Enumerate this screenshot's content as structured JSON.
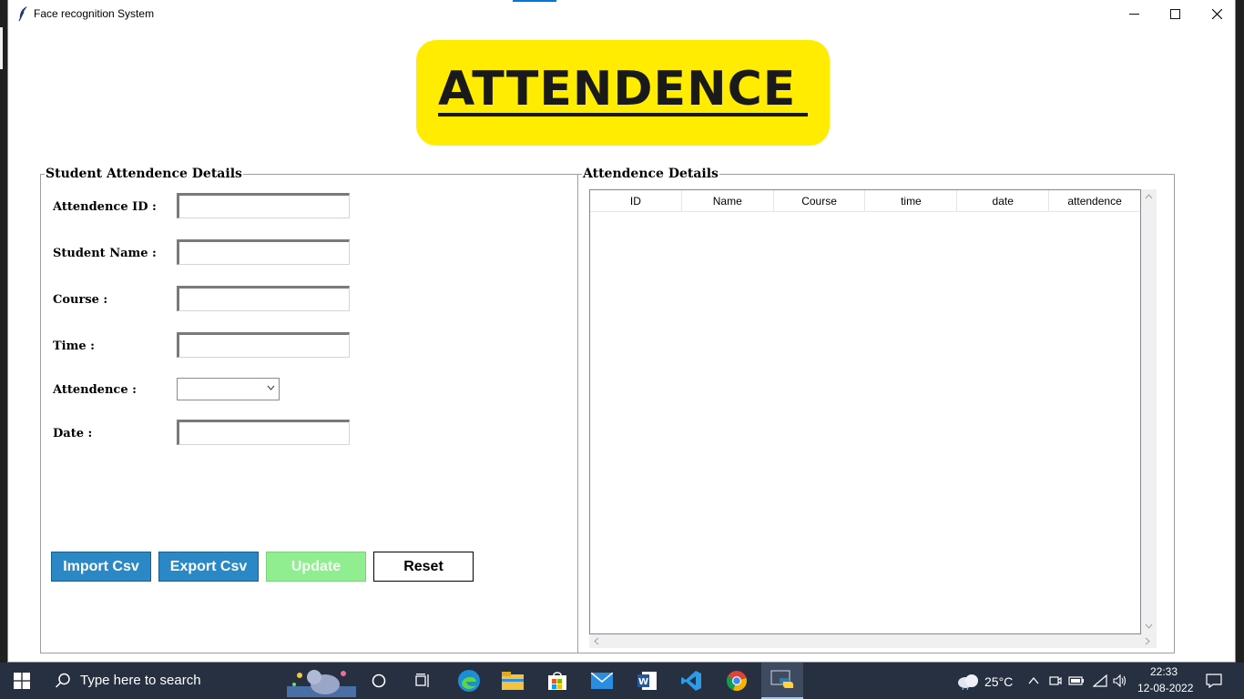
{
  "window": {
    "title": "Face recognition System",
    "minimize_glyph": "—",
    "maximize_glyph": "☐",
    "close_glyph": "✕"
  },
  "banner": {
    "text": "ATTENDENCE"
  },
  "left_frame": {
    "title": "Student Attendence Details",
    "fields": {
      "attendence_id": {
        "label": "Attendence ID :",
        "value": ""
      },
      "student_name": {
        "label": "Student Name :",
        "value": ""
      },
      "course": {
        "label": "Course :",
        "value": ""
      },
      "time": {
        "label": "Time :",
        "value": ""
      },
      "attendence": {
        "label": "Attendence :",
        "selected": ""
      },
      "date": {
        "label": "Date :",
        "value": ""
      }
    },
    "buttons": {
      "import": "Import Csv",
      "export": "Export Csv",
      "update": "Update",
      "reset": "Reset"
    }
  },
  "right_frame": {
    "title": "Attendence Details",
    "columns": [
      "ID",
      "Name",
      "Course",
      "time",
      "date",
      "attendence"
    ],
    "rows": []
  },
  "taskbar": {
    "search_placeholder": "Type here to search",
    "weather": "25°C",
    "time": "22:33",
    "date": "12-08-2022",
    "apps": [
      "start-icon",
      "search-icon",
      "cortana-icon",
      "task-view-icon",
      "edge-icon",
      "file-explorer-icon",
      "store-icon",
      "mail-icon",
      "word-icon",
      "vscode-icon",
      "chrome-icon",
      "python-icon"
    ]
  },
  "colors": {
    "banner": "#ffec00",
    "import_export": "#2b88c6",
    "update": "#90ee90",
    "taskbar": "#273040"
  }
}
